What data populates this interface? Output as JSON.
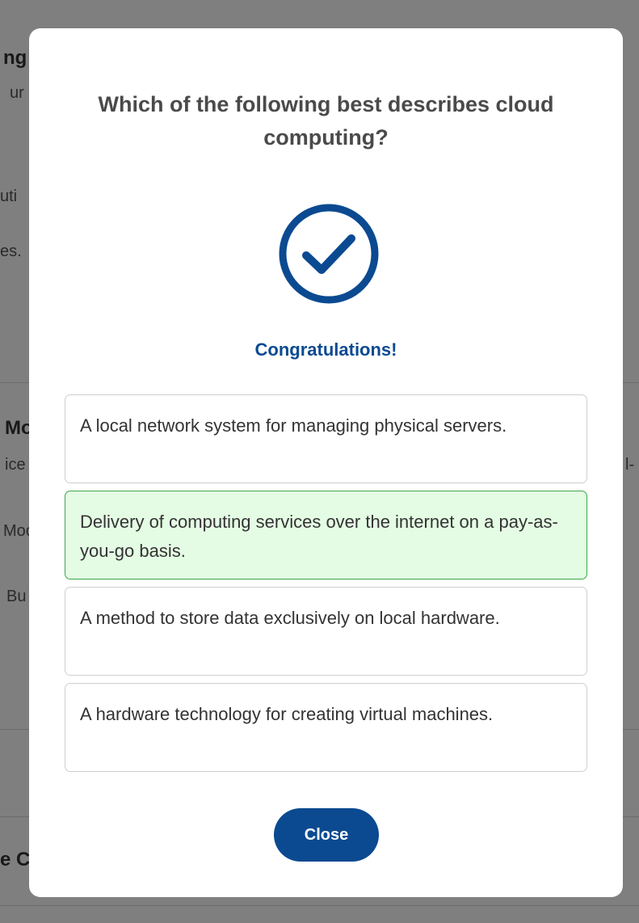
{
  "background": {
    "fragments": [
      "ng",
      "ur",
      "uti",
      "es.",
      "Mo",
      "ice",
      "l-",
      "Moo",
      "Bu",
      "e C"
    ]
  },
  "modal": {
    "question": "Which of the following best describes cloud computing?",
    "result_icon": "check-circle-icon",
    "congrats": "Congratulations!",
    "options": [
      {
        "text": "A local network system for managing physical servers.",
        "state": "default"
      },
      {
        "text": "Delivery of computing services over the internet on a pay-as-you-go basis.",
        "state": "correct"
      },
      {
        "text": "A method to store data exclusively on local hardware.",
        "state": "default"
      },
      {
        "text": "A hardware technology for creating virtual machines.",
        "state": "default"
      }
    ],
    "close_label": "Close"
  },
  "colors": {
    "accent": "#0b4a91",
    "correct_bg": "#e4fbe4",
    "correct_border": "#3aa845"
  }
}
